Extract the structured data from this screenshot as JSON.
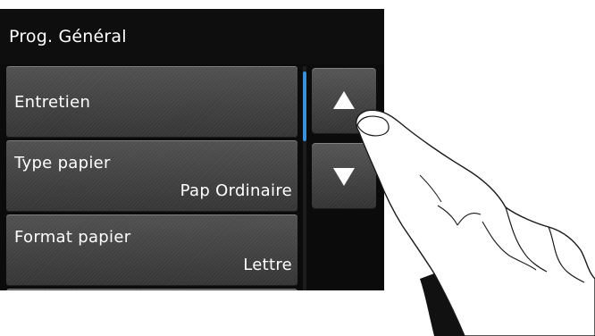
{
  "header": {
    "title": "Prog. Général"
  },
  "menu": {
    "items": [
      {
        "label": "Entretien",
        "value": ""
      },
      {
        "label": "Type papier",
        "value": "Pap Ordinaire"
      },
      {
        "label": "Format papier",
        "value": "Lettre"
      }
    ]
  },
  "scroll": {
    "up_icon": "up-triangle-icon",
    "down_icon": "down-triangle-icon"
  },
  "colors": {
    "screen_background": "#0b0b0b",
    "button_face": "#404040",
    "scrollbar_thumb": "#3a8fd6",
    "text": "#ffffff"
  }
}
